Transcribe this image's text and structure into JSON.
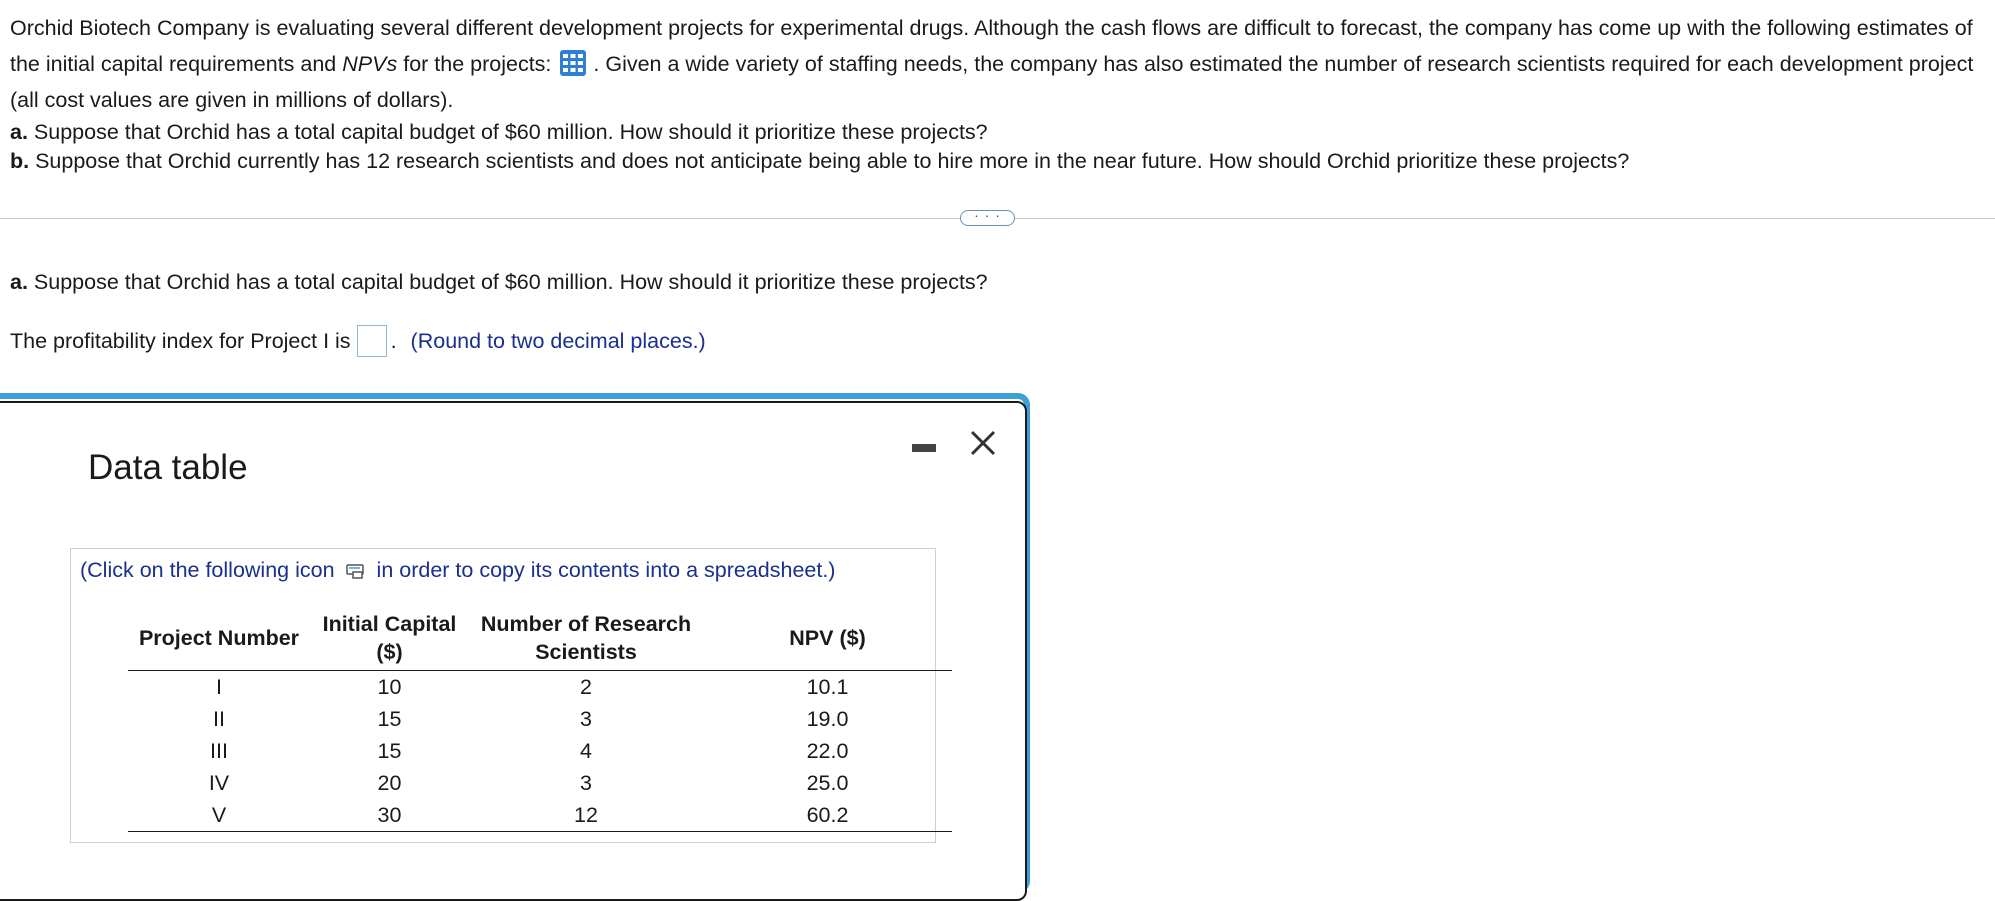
{
  "problem": {
    "intro_part1": "Orchid Biotech Company is evaluating several different development projects for experimental drugs. Although the cash flows are difficult to forecast, the company has come up with the following estimates of the initial capital requirements and",
    "npv_term": "NPVs",
    "intro_part2": "for the projects:",
    "intro_part3": ". Given a wide variety of staffing needs, the company has also estimated the number of research scientists required for each development project (all cost values are given in millions of dollars).",
    "part_a_label": "a.",
    "part_a_text": "Suppose that Orchid has a total capital budget of $60 million. How should it prioritize these projects?",
    "part_b_label": "b.",
    "part_b_text": "Suppose that Orchid currently has 12 research scientists and does not anticipate being able to hire more in the near future. How should Orchid prioritize these projects?"
  },
  "more_button": "· · ·",
  "question": {
    "label": "a.",
    "text": "Suppose that Orchid has a total capital budget of $60 million. How should it prioritize these projects?"
  },
  "answer": {
    "prefix": "The profitability index for Project I is",
    "value": "",
    "suffix": ".",
    "hint": "(Round to two decimal places.)"
  },
  "dialog": {
    "title": "Data table",
    "copy_note_before": "(Click on the following icon",
    "copy_note_after": "in order to copy its contents into a spreadsheet.)",
    "table": {
      "headers": [
        "Project Number",
        "Initial Capital ($)",
        "Number of Research Scientists",
        "NPV ($)"
      ],
      "rows": [
        [
          "I",
          "10",
          "2",
          "10.1"
        ],
        [
          "II",
          "15",
          "3",
          "19.0"
        ],
        [
          "III",
          "15",
          "4",
          "22.0"
        ],
        [
          "IV",
          "20",
          "3",
          "25.0"
        ],
        [
          "V",
          "30",
          "12",
          "60.2"
        ]
      ]
    }
  },
  "icons": {
    "table_icon": "table-grid-icon",
    "copy_icon": "copy-spreadsheet-icon",
    "minimize_icon": "minimize-icon",
    "close_icon": "close-icon"
  },
  "colors": {
    "accent_blue": "#3d9fd8",
    "hint_blue": "#1a2f8f",
    "icon_blue": "#2f7fd4"
  }
}
